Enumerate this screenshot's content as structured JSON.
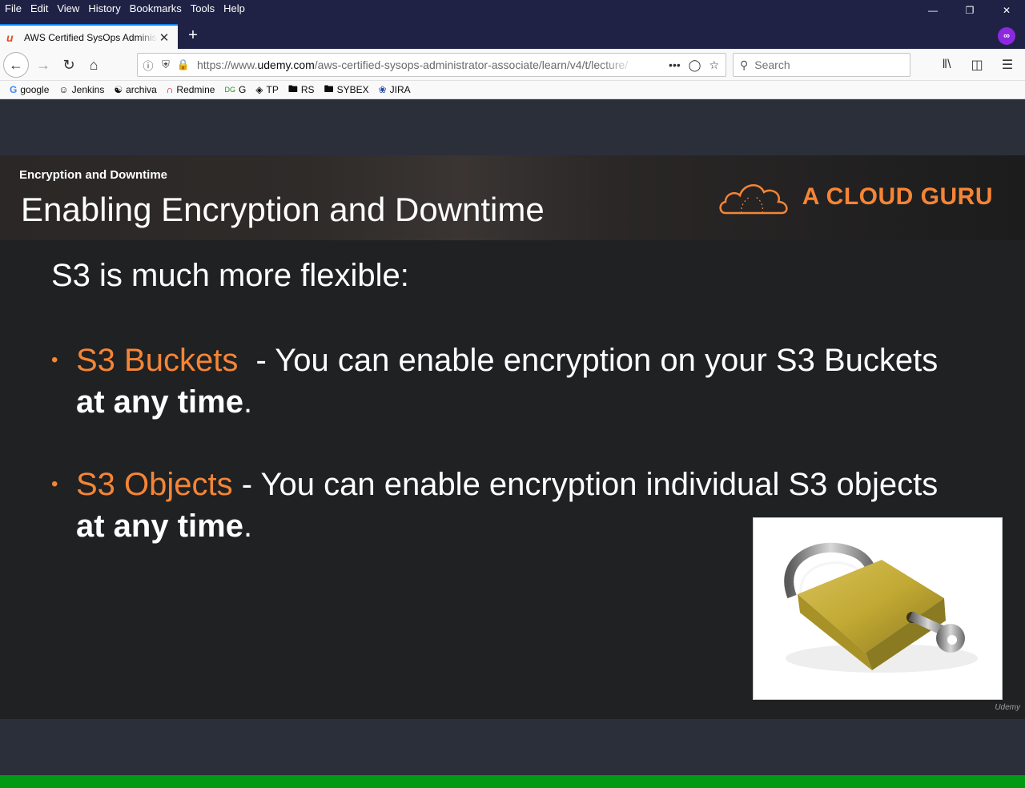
{
  "menu": {
    "items": [
      {
        "u": "F",
        "rest": "ile"
      },
      {
        "u": "E",
        "rest": "dit"
      },
      {
        "u": "V",
        "rest": "iew"
      },
      {
        "u": "",
        "pre": "Hi",
        "mid": "s",
        "rest": "tory"
      },
      {
        "u": "B",
        "rest": "ookmarks"
      },
      {
        "u": "T",
        "rest": "ools"
      },
      {
        "u": "H",
        "rest": "elp"
      }
    ]
  },
  "menu_labels": [
    "File",
    "Edit",
    "View",
    "History",
    "Bookmarks",
    "Tools",
    "Help"
  ],
  "tab": {
    "title": "AWS Certified SysOps Administ",
    "favicon": "udemy-icon"
  },
  "urlbar": {
    "prefix": "https://www.",
    "domain": "udemy.com",
    "path": "/aws-certified-sysops-administrator-associate/learn/v4/t/lecture/"
  },
  "search": {
    "placeholder": "Search"
  },
  "bookmarks": [
    {
      "label": "google",
      "icon": "google-icon"
    },
    {
      "label": "Jenkins",
      "icon": "jenkins-icon"
    },
    {
      "label": "archiva",
      "icon": "globe-icon"
    },
    {
      "label": "Redmine",
      "icon": "redmine-icon"
    },
    {
      "label": "G",
      "icon": "g-icon"
    },
    {
      "label": "TP",
      "icon": "tp-icon"
    },
    {
      "label": "RS",
      "icon": "folder-icon"
    },
    {
      "label": "SYBEX",
      "icon": "folder-icon"
    },
    {
      "label": "JIRA",
      "icon": "jira-icon"
    }
  ],
  "slide": {
    "subtitle": "Encryption and Downtime",
    "title": "Enabling Encryption and Downtime",
    "brand": "A CLOUD GURU",
    "lead": "S3 is much more flexible:",
    "bullets": [
      {
        "highlight": "S3 Buckets",
        "text": "  - You can enable encryption on your S3 Buckets",
        "strong": "at any time",
        "end": "."
      },
      {
        "highlight": "S3 Objects",
        "text": " - You can enable encryption individual S3 objects",
        "strong": "at any time",
        "end": "."
      }
    ],
    "watermark": "Udemy"
  },
  "colors": {
    "accent": "#f58536",
    "progress": "#009a13",
    "titlebar": "#1f2245"
  }
}
